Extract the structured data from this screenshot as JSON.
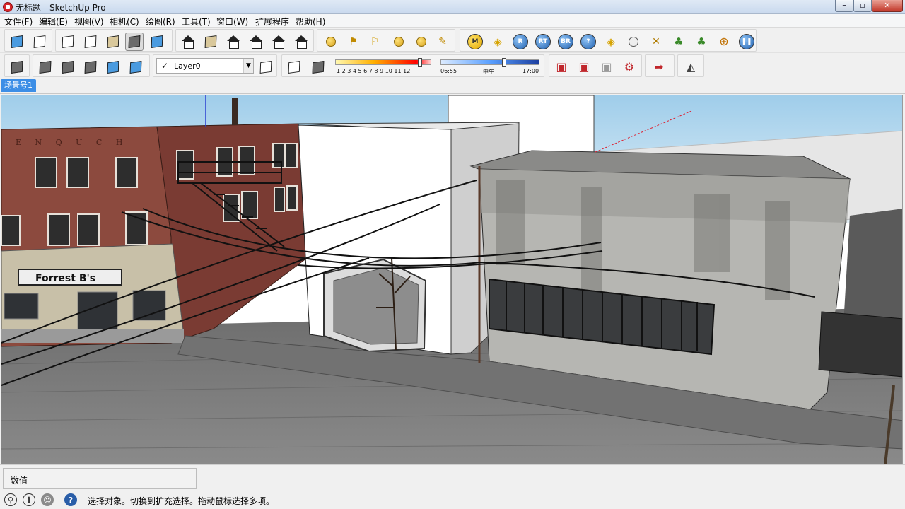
{
  "window": {
    "title": "无标题 - SketchUp Pro"
  },
  "menu": [
    {
      "label": "文件(F)"
    },
    {
      "label": "编辑(E)"
    },
    {
      "label": "视图(V)"
    },
    {
      "label": "相机(C)"
    },
    {
      "label": "绘图(R)"
    },
    {
      "label": "工具(T)"
    },
    {
      "label": "窗口(W)"
    },
    {
      "label": "扩展程序"
    },
    {
      "label": "帮助(H)"
    }
  ],
  "toolbar": {
    "layer": {
      "check": "✓",
      "name": "Layer0",
      "dropdown": "▼"
    },
    "shadow_months": {
      "ticks": "1  2  3  4  5  6  7  8  9  10 11 12"
    },
    "shadow_time": {
      "start": "06:55",
      "mid": "中午",
      "end": "17:00"
    },
    "plugins": {
      "m": "M",
      "r": "R",
      "rt": "RT",
      "br": "BR",
      "help": "?"
    }
  },
  "scene": {
    "tab": "场景号1"
  },
  "viewport": {
    "sign_text": "Forrest B's",
    "facade_letters": "E N Q U C H"
  },
  "vcb": {
    "label": "数值"
  },
  "status": {
    "text": "选择对象。切换到扩充选择。拖动鼠标选择多项。",
    "info_icon": "i",
    "help_icon": "?"
  },
  "colors": {
    "accent": "#3c8ee6",
    "title_bar": "#c9d9ee",
    "sky": "#b9dcf0"
  }
}
